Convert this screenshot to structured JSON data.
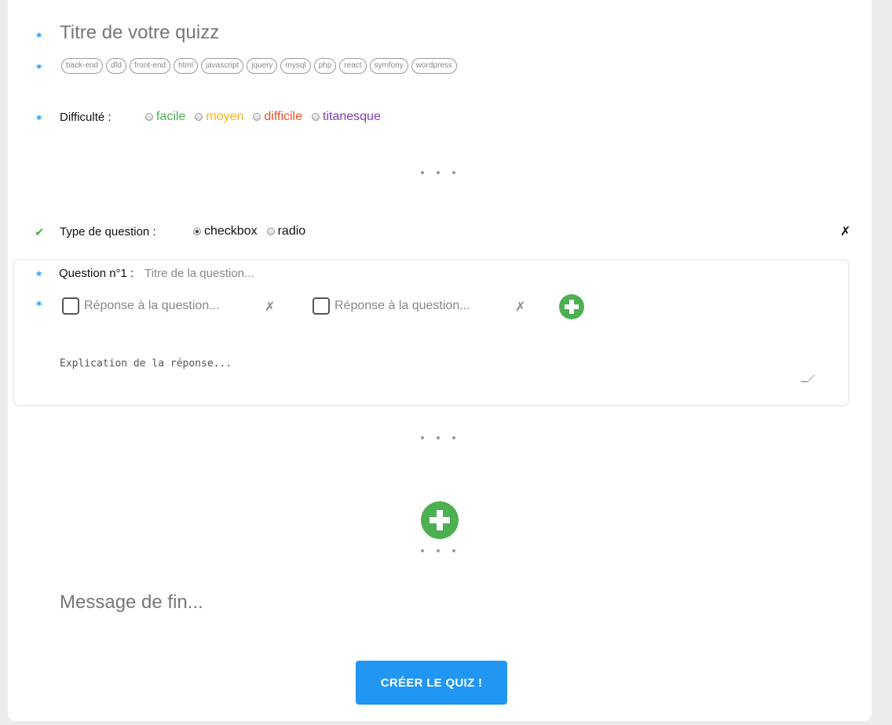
{
  "form": {
    "title_placeholder": "Titre de votre quizz",
    "tags": [
      "back-end",
      "dfd",
      "front-end",
      "html",
      "javascript",
      "jquery",
      "mysql",
      "php",
      "react",
      "symfony",
      "wordpress"
    ],
    "difficulty_label": "Difficulté :",
    "difficulties": [
      {
        "label": "facile",
        "color": "#4caf50"
      },
      {
        "label": "moyen",
        "color": "#f5b120"
      },
      {
        "label": "difficile",
        "color": "#e8502a"
      },
      {
        "label": "titanesque",
        "color": "#7b3fb5"
      }
    ],
    "question_type_label": "Type de question :",
    "question_types": [
      {
        "label": "checkbox",
        "selected": true
      },
      {
        "label": "radio",
        "selected": false
      }
    ],
    "close_symbol": "✗"
  },
  "question": {
    "label": "Question n°1 :",
    "placeholder": "Titre de la question...",
    "answers": [
      {
        "placeholder": "Réponse à la question...",
        "delete_symbol": "✗"
      },
      {
        "placeholder": "Réponse à la question...",
        "delete_symbol": "✗"
      }
    ],
    "explanation_placeholder": "Explication de la réponse..."
  },
  "end_message_placeholder": "Message de fin...",
  "submit_label": "CRÉER LE QUIZ !",
  "colors": {
    "accent": "#2196f3",
    "add": "#4caf50"
  }
}
